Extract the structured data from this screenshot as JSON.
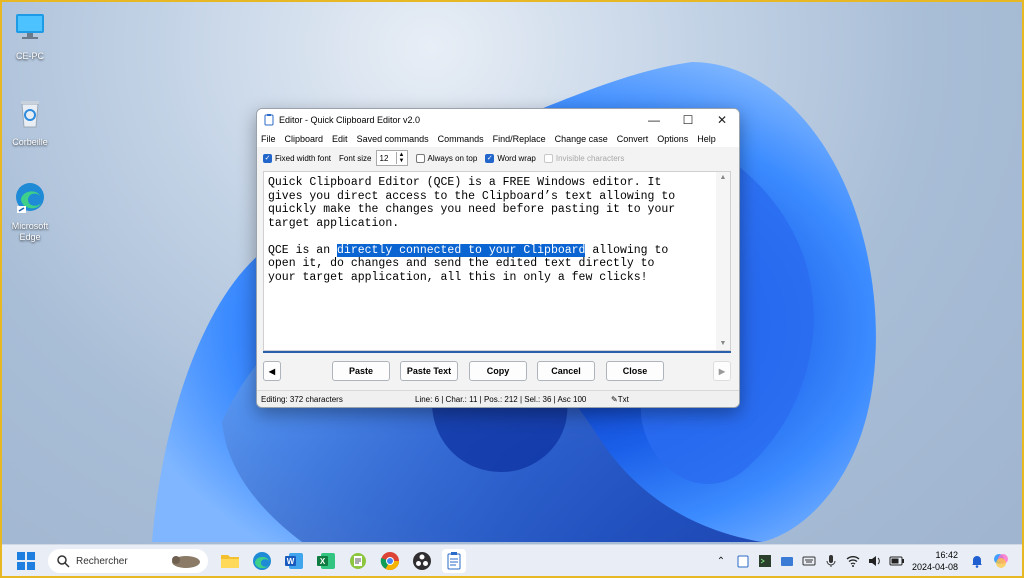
{
  "desktop": {
    "icons": [
      {
        "label": "CE-PC",
        "icon": "monitor-icon"
      },
      {
        "label": "Corbeille",
        "icon": "recycle-bin-icon"
      },
      {
        "label": "Microsoft Edge",
        "icon": "edge-icon"
      }
    ]
  },
  "window": {
    "title": "Editor - Quick Clipboard Editor v2.0",
    "menu": [
      "File",
      "Clipboard",
      "Edit",
      "Saved commands",
      "Commands",
      "Find/Replace",
      "Change case",
      "Convert",
      "Options",
      "Help"
    ],
    "options": {
      "fixed_width_font": {
        "label": "Fixed width font",
        "checked": true
      },
      "font_size_label": "Font size",
      "font_size_value": "12",
      "always_on_top": {
        "label": "Always on top",
        "checked": false
      },
      "word_wrap": {
        "label": "Word wrap",
        "checked": true
      },
      "invisible_characters": {
        "label": "Invisible characters",
        "checked": false,
        "disabled": true
      }
    },
    "editor": {
      "line1": "Quick Clipboard Editor (QCE) is a FREE Windows editor. It",
      "line2": "gives you direct access to the Clipboard’s text allowing to",
      "line3": "quickly make the changes you need before pasting it to your",
      "line4": "target application.",
      "line6_pre": "QCE is an ",
      "line6_sel": "directly connected to your Clipboard",
      "line6_post": " allowing to",
      "line7": "open it, do changes and send the edited text directly to",
      "line8": "your target application, all this in only a few clicks!"
    },
    "buttons": {
      "prev": "◀",
      "paste": "Paste",
      "paste_text": "Paste Text",
      "copy": "Copy",
      "cancel": "Cancel",
      "close": "Close",
      "next": "▶"
    },
    "status": {
      "editing": "Editing: 372 characters",
      "position": "Line: 6  |  Char.: 11  |  Pos.: 212  |  Sel.: 36  |  Asc 100",
      "mode": "Txt"
    }
  },
  "taskbar": {
    "search_placeholder": "Rechercher",
    "apps": [
      "file-explorer-icon",
      "edge-icon",
      "word-icon",
      "excel-icon",
      "notepad-plus-icon",
      "chrome-icon",
      "obs-icon",
      "qce-icon"
    ],
    "time": "16:42",
    "date": "2024-04-08"
  },
  "colors": {
    "selection": "#0a64d2",
    "accent": "#2266cc",
    "frame_border": "#e8b824"
  }
}
